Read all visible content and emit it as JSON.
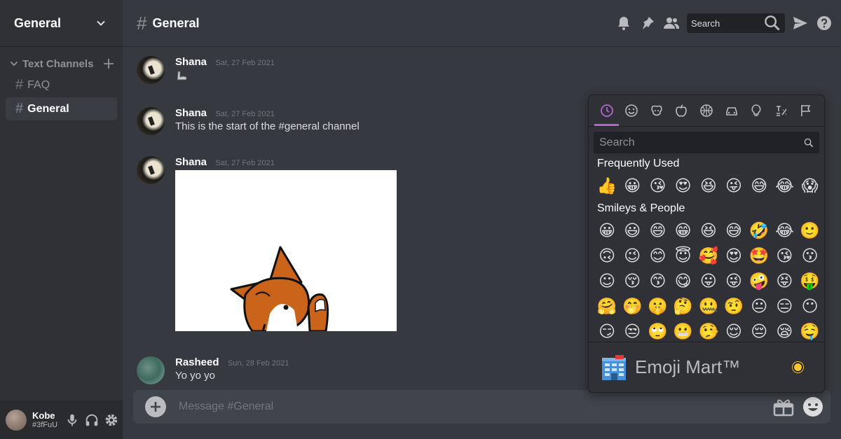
{
  "sidebar": {
    "server_name": "General",
    "category": "Text Channels",
    "channels": [
      {
        "name": "FAQ",
        "active": false
      },
      {
        "name": "General",
        "active": true
      }
    ],
    "user": {
      "name": "Kobe",
      "tag": "#3fFuU"
    }
  },
  "header": {
    "channel": "General",
    "search_placeholder": "Search"
  },
  "messages": [
    {
      "author": "Shana",
      "timestamp": "Sat, 27 Feb 2021",
      "text": ""
    },
    {
      "author": "Shana",
      "timestamp": "Sat, 27 Feb 2021",
      "text": "This is the start of the #general channel"
    },
    {
      "author": "Shana",
      "timestamp": "Sat, 27 Feb 2021",
      "text": ""
    },
    {
      "author": "Rasheed",
      "timestamp": "Sun, 28 Feb 2021",
      "text": "Yo yo yo"
    }
  ],
  "composer": {
    "placeholder": "Message #General"
  },
  "emoji_picker": {
    "search_placeholder": "Search",
    "frequently_used_title": "Frequently Used",
    "frequently_used": [
      "👍",
      "😀",
      "😘",
      "😍",
      "😆",
      "😜",
      "😅",
      "😂",
      "😱"
    ],
    "smileys_title": "Smileys & People",
    "smileys_rows": [
      [
        "😀",
        "😃",
        "😄",
        "😁",
        "😆",
        "😅",
        "🤣",
        "😂",
        "🙂"
      ],
      [
        "🙃",
        "😉",
        "😊",
        "😇",
        "🥰",
        "😍",
        "🤩",
        "😘",
        "😗"
      ],
      [
        "☺",
        "😚",
        "😙",
        "😋",
        "😛",
        "😜",
        "🤪",
        "😝",
        "🤑"
      ],
      [
        "🤗",
        "🤭",
        "🤫",
        "🤔",
        "🤐",
        "🤨",
        "😐",
        "😑",
        "😶"
      ],
      [
        "😏",
        "😒",
        "🙄",
        "😬",
        "🤥",
        "😌",
        "😔",
        "😪",
        "🤤"
      ]
    ],
    "footer_name": "Emoji Mart™",
    "accent_color": "#b365d1"
  }
}
